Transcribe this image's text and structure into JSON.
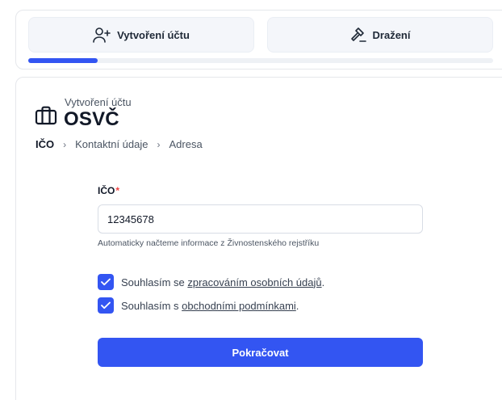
{
  "stepper": {
    "tabs": [
      {
        "label": "Vytvoření účtu",
        "icon": "user-plus-icon"
      },
      {
        "label": "Dražení",
        "icon": "gavel-icon"
      }
    ],
    "progress_fraction": 0.15,
    "accent_color": "#3355f2"
  },
  "form": {
    "header_icon": "briefcase-icon",
    "subtitle": "Vytvoření účtu",
    "title": "OSVČ",
    "breadcrumb": [
      "IČO",
      "Kontaktní údaje",
      "Adresa"
    ],
    "ico_label": "IČO",
    "required_mark": "*",
    "ico_value": "12345678",
    "ico_helper": "Automaticky načteme informace z Živnostenského rejstříku",
    "consent_personal": {
      "prefix": "Souhlasím se ",
      "link": "zpracováním osobních údajů",
      "suffix": ".",
      "checked": true
    },
    "consent_terms": {
      "prefix": "Souhlasím s ",
      "link": "obchodními podmínkami",
      "suffix": ".",
      "checked": true
    },
    "submit_label": "Pokračovat"
  }
}
